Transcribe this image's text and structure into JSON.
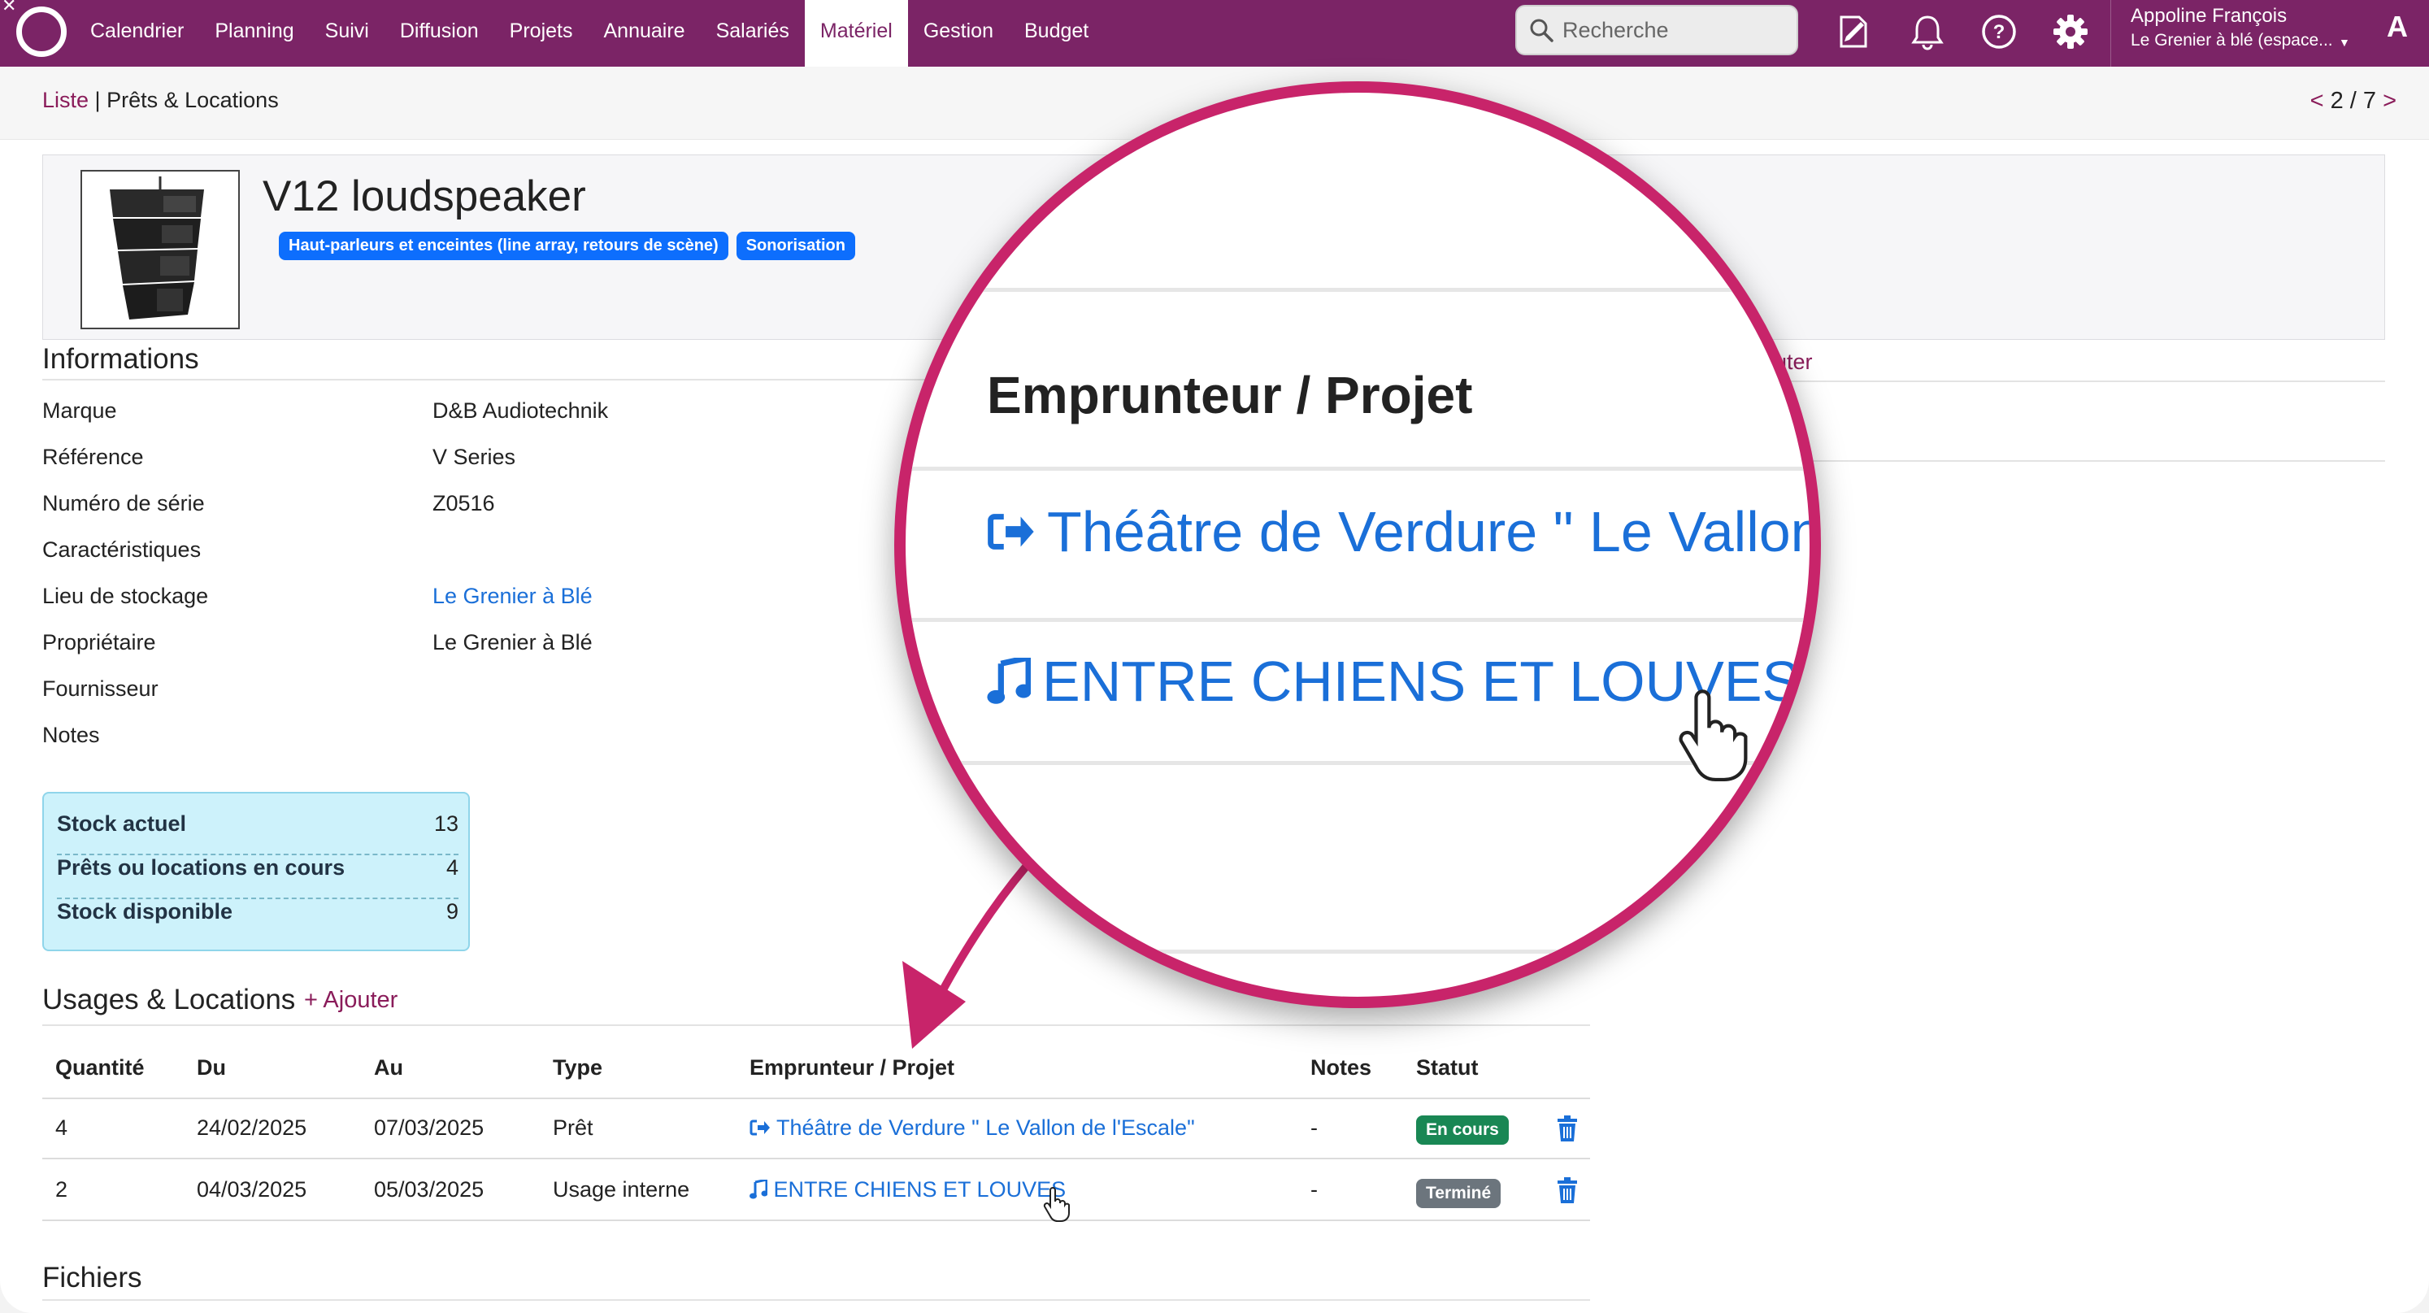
{
  "nav": {
    "items": [
      "Calendrier",
      "Planning",
      "Suivi",
      "Diffusion",
      "Projets",
      "Annuaire",
      "Salariés",
      "Matériel",
      "Gestion",
      "Budget"
    ],
    "active": "Matériel",
    "search_placeholder": "Recherche",
    "user_name": "Appoline François",
    "user_space": "Le Grenier à blé (espace...",
    "avatar_letter": "A"
  },
  "breadcrumb": {
    "list_link": "Liste",
    "separator": " | ",
    "current": "Prêts & Locations",
    "pager_prev": "<",
    "pager_text": "2 / 7",
    "pager_next": ">"
  },
  "item": {
    "title": "V12 loudspeaker",
    "tags": [
      "Haut-parleurs et enceintes (line array, retours de scène)",
      "Sonorisation"
    ]
  },
  "info": {
    "title": "Informations",
    "rows": [
      {
        "label": "Marque",
        "value": "D&B Audiotechnik"
      },
      {
        "label": "Référence",
        "value": "V Series"
      },
      {
        "label": "Numéro de série",
        "value": "Z0516"
      },
      {
        "label": "Caractéristiques",
        "value": ""
      },
      {
        "label": "Lieu de stockage",
        "value": "Le Grenier à Blé"
      },
      {
        "label": "Propriétaire",
        "value": "Le Grenier à Blé"
      },
      {
        "label": "Fournisseur",
        "value": ""
      },
      {
        "label": "Notes",
        "value": ""
      }
    ]
  },
  "right_panel": {
    "link1": "outer",
    "link2": "er"
  },
  "stock": {
    "rows": [
      {
        "label": "Stock actuel",
        "value": "13"
      },
      {
        "label": "Prêts ou locations en cours",
        "value": "4"
      },
      {
        "label": "Stock disponible",
        "value": "9"
      }
    ]
  },
  "usages": {
    "title": "Usages & Locations",
    "add_label": "Ajouter",
    "headers": [
      "Quantité",
      "Du",
      "Au",
      "Type",
      "Emprunteur / Projet",
      "Notes",
      "Statut"
    ],
    "rows": [
      {
        "qty": "4",
        "from": "24/02/2025",
        "to": "07/03/2025",
        "type": "Prêt",
        "borrower": "Théâtre de Verdure \" Le Vallon de l'Escale\"",
        "notes": "-",
        "status": "En cours"
      },
      {
        "qty": "2",
        "from": "04/03/2025",
        "to": "05/03/2025",
        "type": "Usage interne",
        "borrower": "ENTRE CHIENS ET LOUVES",
        "notes": "-",
        "status": "Terminé"
      }
    ]
  },
  "files": {
    "title": "Fichiers"
  },
  "magnifier": {
    "heading": "Emprunteur / Projet",
    "row1": "Théâtre de Verdure \" Le Vallon de",
    "row2": "ENTRE CHIENS ET LOUVES"
  },
  "colors": {
    "brand": "#7b2466",
    "accent_link": "#8a1c5a",
    "link_blue": "#1a6fd8",
    "badge_blue": "#0d6efd",
    "status_ongoing": "#198754",
    "status_done": "#6c757d",
    "magnifier_ring": "#c8246a"
  }
}
